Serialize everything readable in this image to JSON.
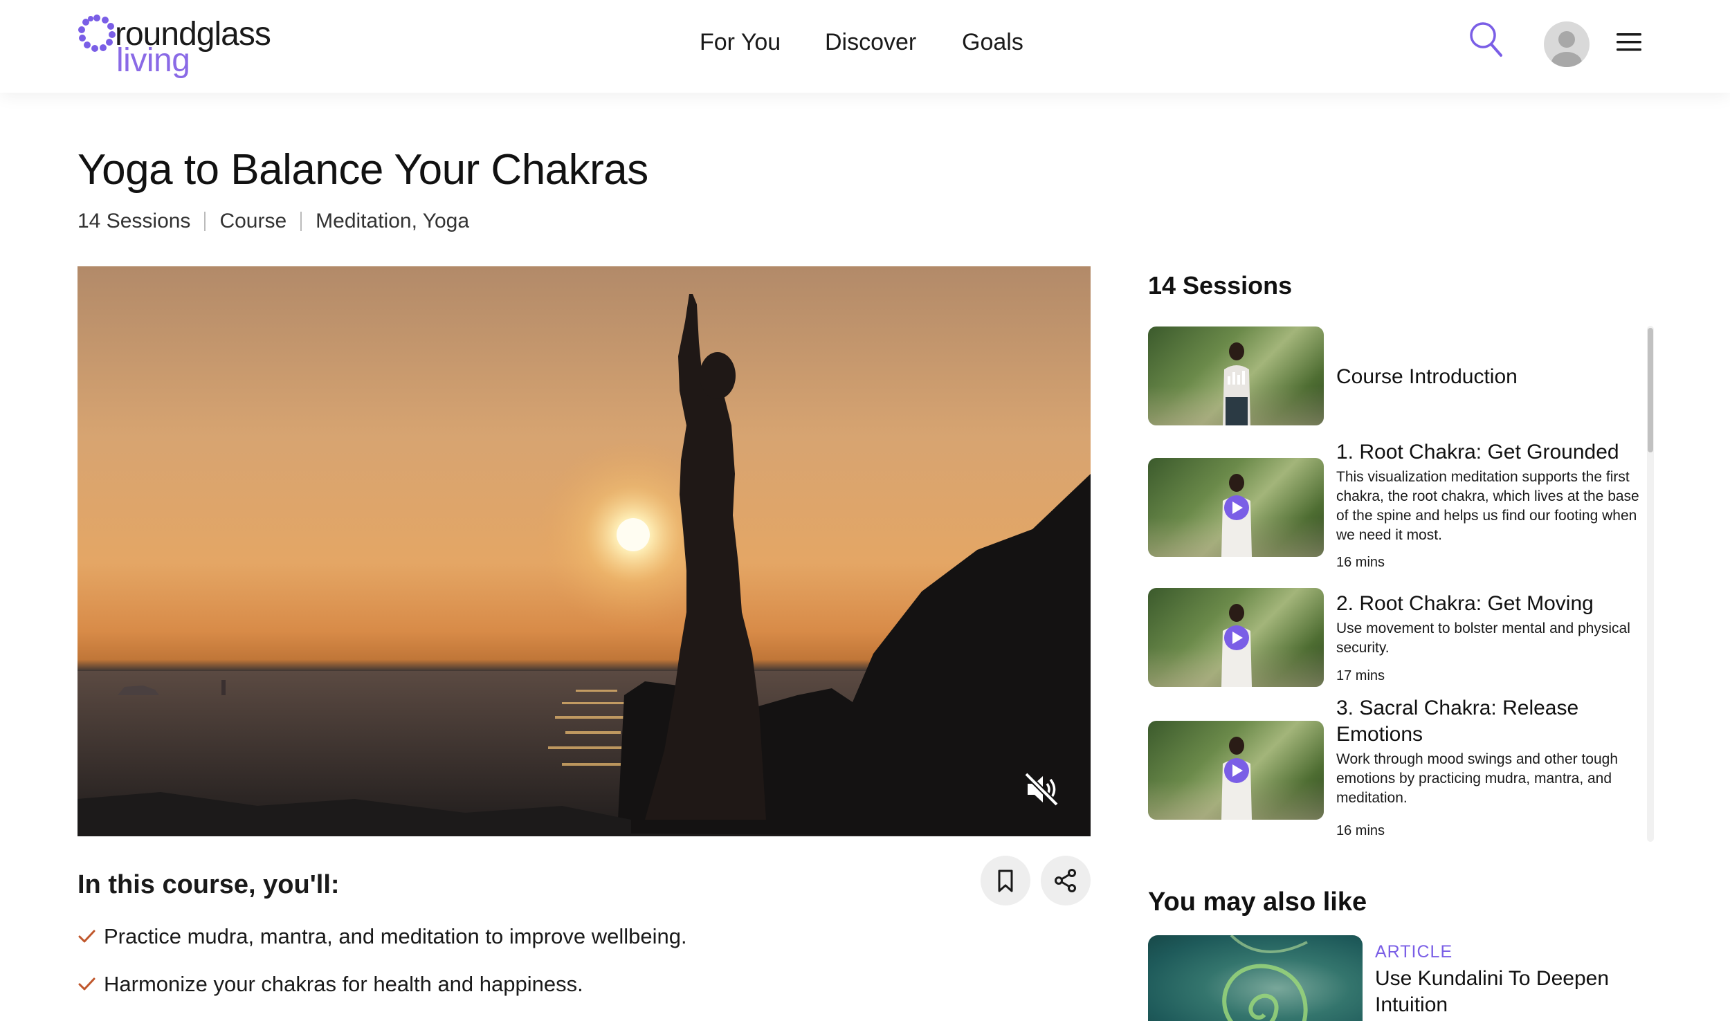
{
  "header": {
    "logo_word1": "roundglass",
    "logo_word2": "living",
    "nav": {
      "for_you": "For You",
      "discover": "Discover",
      "goals": "Goals"
    },
    "brand_color": "#8a6ae6"
  },
  "course": {
    "title": "Yoga to Balance Your Chakras",
    "meta": {
      "sessions": "14 Sessions",
      "type": "Course",
      "categories": "Meditation, Yoga"
    },
    "intro_heading": "In this course, you'll:",
    "goals": [
      "Practice mudra, mantra, and meditation to improve wellbeing.",
      "Harmonize your chakras for health and happiness."
    ]
  },
  "sessions_panel": {
    "heading": "14 Sessions",
    "items": [
      {
        "title": "Course Introduction",
        "description": "",
        "duration": "",
        "state": "playing"
      },
      {
        "title": "1. Root Chakra: Get Grounded",
        "description": "This visualization meditation supports the first chakra, the root chakra, which lives at the base of the spine and helps us find our footing when we need it most.",
        "duration": "16 mins",
        "state": "play"
      },
      {
        "title": "2. Root Chakra: Get Moving",
        "description": "Use movement to bolster mental and physical security.",
        "duration": "17 mins",
        "state": "play"
      },
      {
        "title": "3. Sacral Chakra: Release Emotions",
        "description": "Work through mood swings and other tough emotions by practicing mudra, mantra, and meditation.",
        "duration": "16 mins",
        "state": "play"
      }
    ]
  },
  "also_like": {
    "heading": "You may also like",
    "card": {
      "category": "ARTICLE",
      "title": "Use Kundalini To Deepen Intuition"
    }
  },
  "icons": {
    "search": "search-icon",
    "avatar": "user-avatar-icon",
    "menu": "hamburger-menu-icon",
    "mute": "speaker-muted-icon",
    "bookmark": "bookmark-icon",
    "share": "share-icon",
    "check": "checkmark-icon",
    "play": "play-icon",
    "now_playing": "equalizer-bars-icon"
  },
  "colors": {
    "accent": "#7a5ee6",
    "check": "#c0572c"
  }
}
